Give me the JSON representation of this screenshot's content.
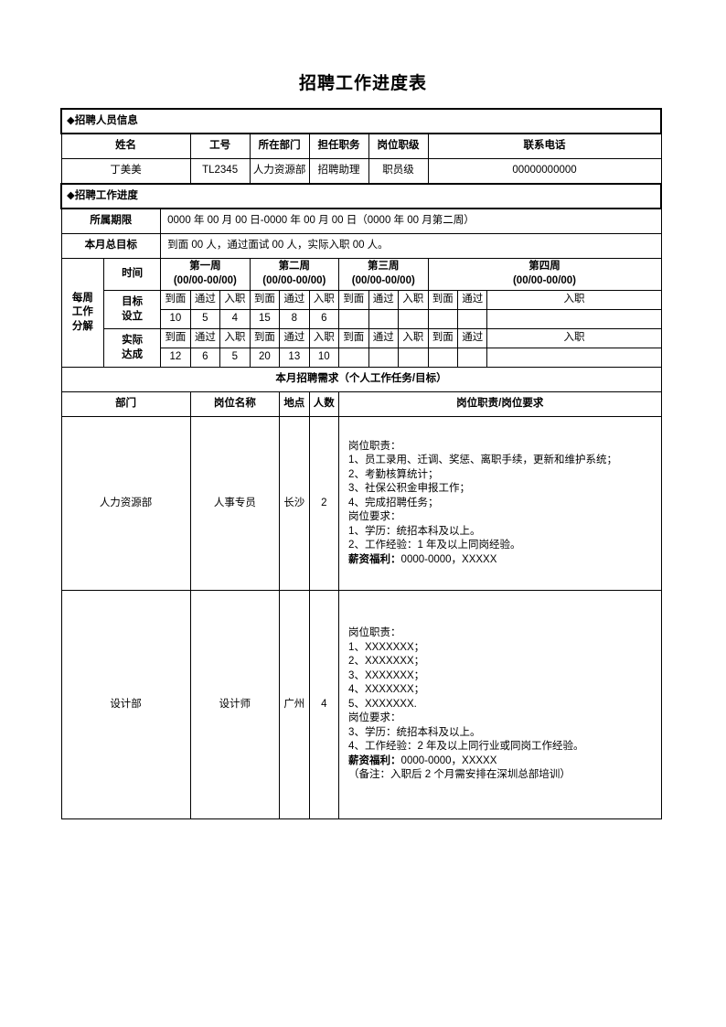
{
  "document": {
    "title": "招聘工作进度表"
  },
  "section_staff": {
    "heading": "◆招聘人员信息",
    "columns": [
      "姓名",
      "工号",
      "所在部门",
      "担任职务",
      "岗位职级",
      "联系电话"
    ],
    "values": [
      "丁美美",
      "TL2345",
      "人力资源部",
      "招聘助理",
      "职员级",
      "00000000000"
    ]
  },
  "section_progress": {
    "heading": "◆招聘工作进度",
    "period_label": "所属期限",
    "period_value": "0000 年 00 月 00 日-0000 年 00 月 00 日（0000 年 00 月第二周）",
    "target_label": "本月总目标",
    "target_value": "到面 00 人，通过面试 00 人，实际入职 00 人。",
    "breakdown_label": "每周\n工作\n分解",
    "time_label": "时间",
    "goal_label": "目标\n设立",
    "actual_label": "实际\n达成",
    "weeks": [
      {
        "name": "第一周",
        "range": "(00/00-00/00)"
      },
      {
        "name": "第二周",
        "range": "(00/00-00/00)"
      },
      {
        "name": "第三周",
        "range": "(00/00-00/00)"
      },
      {
        "name": "第四周",
        "range": "(00/00-00/00)"
      }
    ],
    "metrics": [
      "到面",
      "通过",
      "入职"
    ],
    "goal_values": [
      [
        "10",
        "5",
        "4"
      ],
      [
        "15",
        "8",
        "6"
      ],
      [
        "",
        "",
        ""
      ],
      [
        "",
        "",
        ""
      ]
    ],
    "actual_values": [
      [
        "12",
        "6",
        "5"
      ],
      [
        "20",
        "13",
        "10"
      ],
      [
        "",
        "",
        ""
      ],
      [
        "",
        "",
        ""
      ]
    ]
  },
  "section_needs": {
    "heading": "本月招聘需求（个人工作任务/目标）",
    "columns": [
      "部门",
      "岗位名称",
      "地点",
      "人数",
      "岗位职责/岗位要求"
    ],
    "rows": [
      {
        "department": "人力资源部",
        "position": "人事专员",
        "location": "长沙",
        "headcount": "2",
        "description": "岗位职责：\n1、员工录用、迁调、奖惩、离职手续，更新和维护系统；\n2、考勤核算统计；\n3、社保公积金申报工作；\n4、完成招聘任务；\n岗位要求：\n1、学历：统招本科及以上。\n2、工作经验：1 年及以上同岗经验。",
        "salary_label": "薪资福利：",
        "salary_value": "0000-0000，XXXXX",
        "note": ""
      },
      {
        "department": "设计部",
        "position": "设计师",
        "location": "广州",
        "headcount": "4",
        "description": "岗位职责：\n1、XXXXXXX；\n2、XXXXXXX；\n3、XXXXXXX；\n4、XXXXXXX；\n5、XXXXXXX.\n岗位要求：\n3、学历：统招本科及以上。\n4、工作经验：2 年及以上同行业或同岗工作经验。",
        "salary_label": "薪资福利：",
        "salary_value": "0000-0000，XXXXX",
        "note": "（备注：入职后 2 个月需安排在深圳总部培训）"
      }
    ]
  }
}
